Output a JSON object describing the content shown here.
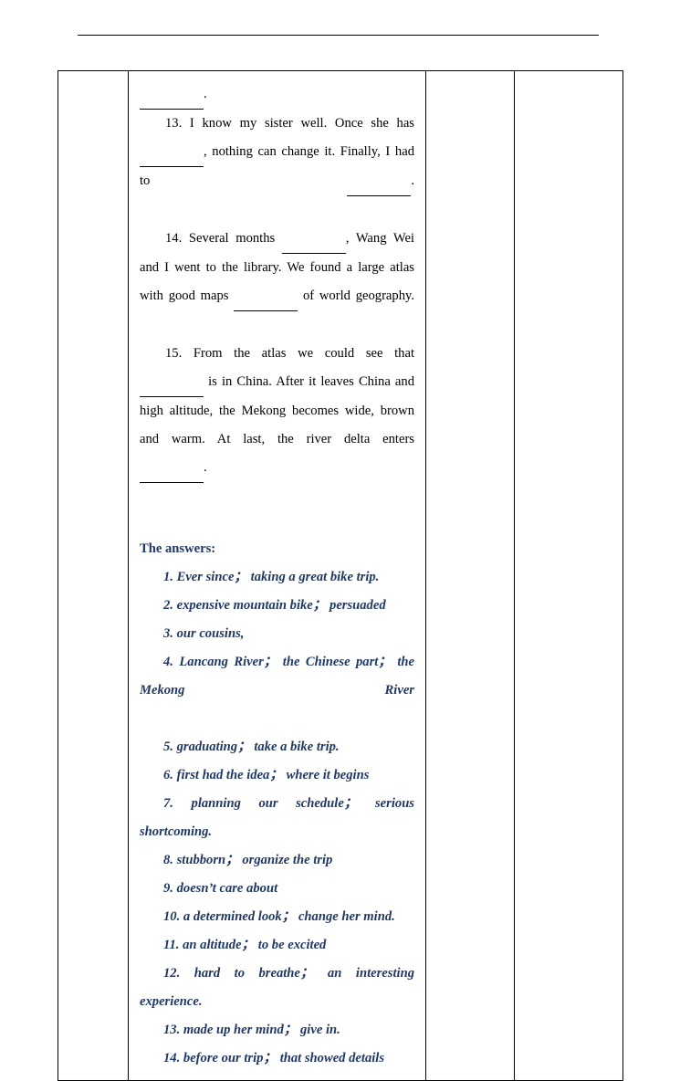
{
  "page": {
    "header_rule": true,
    "background": "#ffffff",
    "text_color": "#000000",
    "answer_color": "#1f3864"
  },
  "table": {
    "columns": [
      "",
      "",
      "",
      ""
    ],
    "column_count": 4
  },
  "exercise": {
    "items": [
      {
        "id": "item-12-tail",
        "segments": [
          {
            "type": "blank"
          },
          {
            "type": "text",
            "value": "."
          }
        ],
        "indent": false,
        "justify": false
      },
      {
        "id": "item-13",
        "segments": [
          {
            "type": "text",
            "value": "13. I know my sister well. Once she has "
          },
          {
            "type": "blank"
          },
          {
            "type": "text",
            "value": ", nothing can change it. Finally, I had to "
          },
          {
            "type": "blank"
          },
          {
            "type": "text",
            "value": "."
          }
        ],
        "indent": true,
        "justify": true
      },
      {
        "id": "item-14",
        "segments": [
          {
            "type": "text",
            "value": "14. Several months "
          },
          {
            "type": "blank"
          },
          {
            "type": "text",
            "value": ", Wang Wei and I went to the library. We found a large atlas with good maps "
          },
          {
            "type": "blank"
          },
          {
            "type": "text",
            "value": " of world geography."
          }
        ],
        "indent": true,
        "justify": true
      },
      {
        "id": "item-15",
        "segments": [
          {
            "type": "text",
            "value": "15. From the atlas we could see that "
          },
          {
            "type": "blank"
          },
          {
            "type": "text",
            "value": " is in China. After it leaves China and high altitude, the Mekong becomes wide, brown and warm. At last, the river delta enters "
          },
          {
            "type": "blank"
          },
          {
            "type": "text",
            "value": "."
          }
        ],
        "indent": true,
        "justify": true
      }
    ]
  },
  "answers": {
    "title": "The answers:",
    "lines": [
      "1. Ever since；  taking a great bike trip.",
      "2. expensive mountain bike；  persuaded",
      "3. our cousins,",
      "4. Lancang River；  the Chinese part；  the Mekong River",
      "5. graduating；  take a bike trip.",
      "6. first had the idea；  where it begins",
      "7. planning our schedule；  serious shortcoming.",
      "8. stubborn；  organize the trip",
      "9. doesn’t care about",
      "10. a determined look；  change her mind.",
      "11. an altitude；  to be excited",
      "12. hard to breathe；  an interesting experience.",
      "13.  made up her mind；  give in.",
      "14. before our trip；  that showed details"
    ],
    "wrapping_index": 3
  }
}
